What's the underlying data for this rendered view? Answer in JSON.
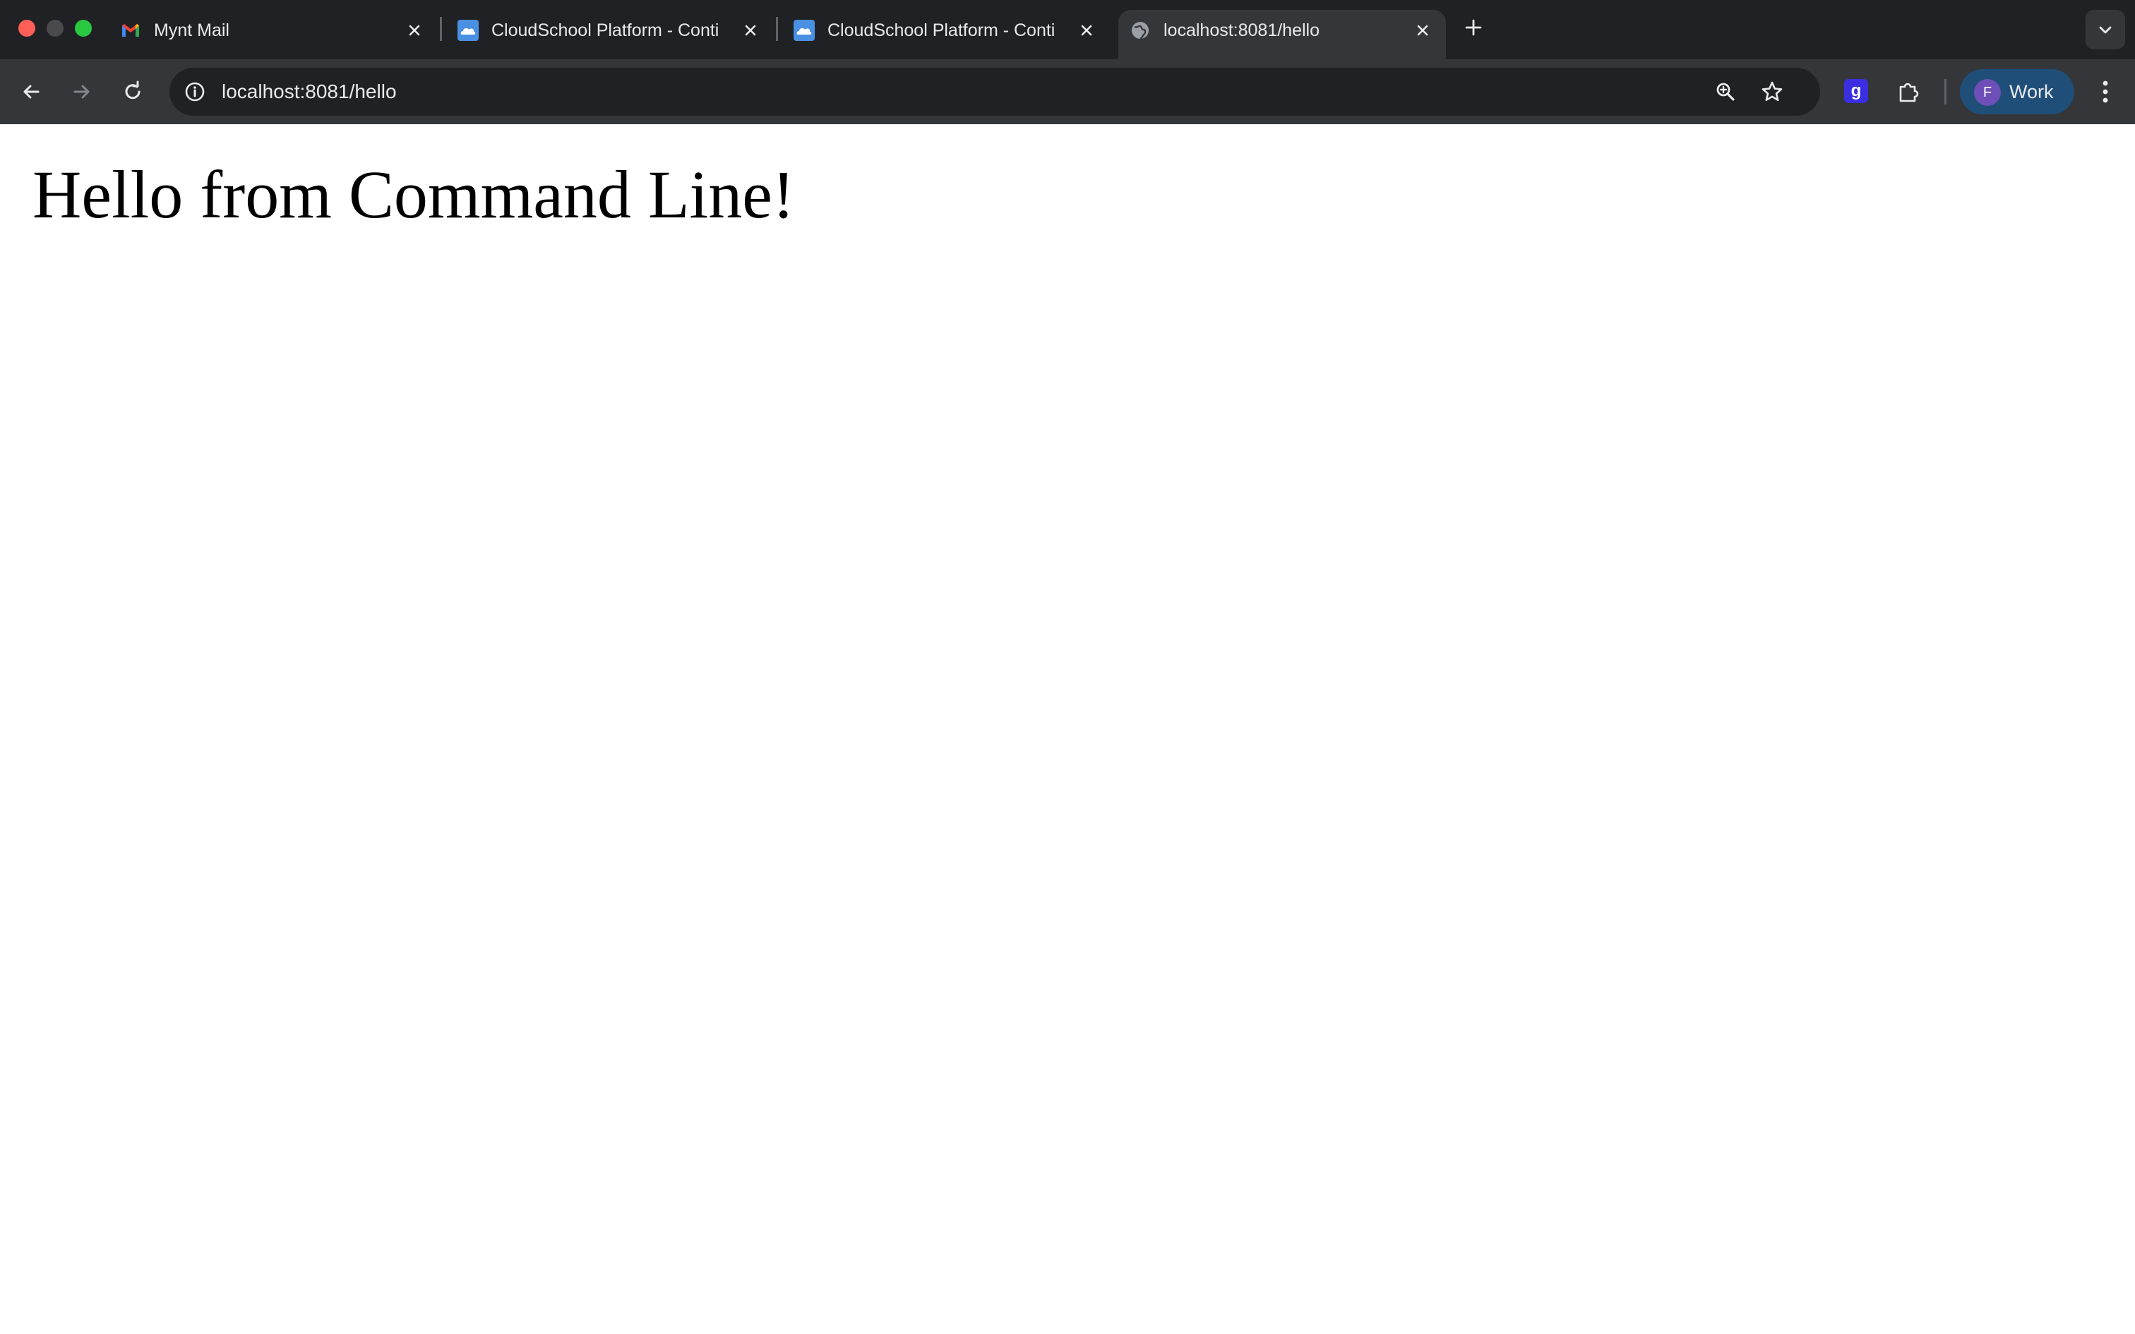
{
  "window": {
    "traffic_lights": [
      "close",
      "minimize",
      "zoom"
    ]
  },
  "tabs": [
    {
      "label": "Mynt Mail",
      "favicon": "gmail-icon",
      "active": false
    },
    {
      "label": "CloudSchool Platform - Conti",
      "favicon": "cloud-icon",
      "active": false
    },
    {
      "label": "CloudSchool Platform - Conti",
      "favicon": "cloud-icon",
      "active": false
    },
    {
      "label": "localhost:8081/hello",
      "favicon": "globe-icon",
      "active": true
    }
  ],
  "toolbar": {
    "url": "localhost:8081/hello",
    "icons": [
      "back-icon",
      "forward-icon",
      "reload-icon",
      "info-icon",
      "zoom-icon",
      "star-icon",
      "glasp-extension-icon",
      "extensions-puzzle-icon",
      "menu-dots-icon"
    ]
  },
  "extension": {
    "glasp_letter": "g"
  },
  "profile": {
    "initial": "F",
    "label": "Work"
  },
  "page": {
    "heading": "Hello from Command Line!"
  },
  "colors": {
    "tabstrip": "#202124",
    "toolbar": "#35363a",
    "omnibox": "#202124",
    "profile_chip": "#1f4e79",
    "avatar": "#6e4fb8",
    "glasp": "#3a2ee0"
  }
}
